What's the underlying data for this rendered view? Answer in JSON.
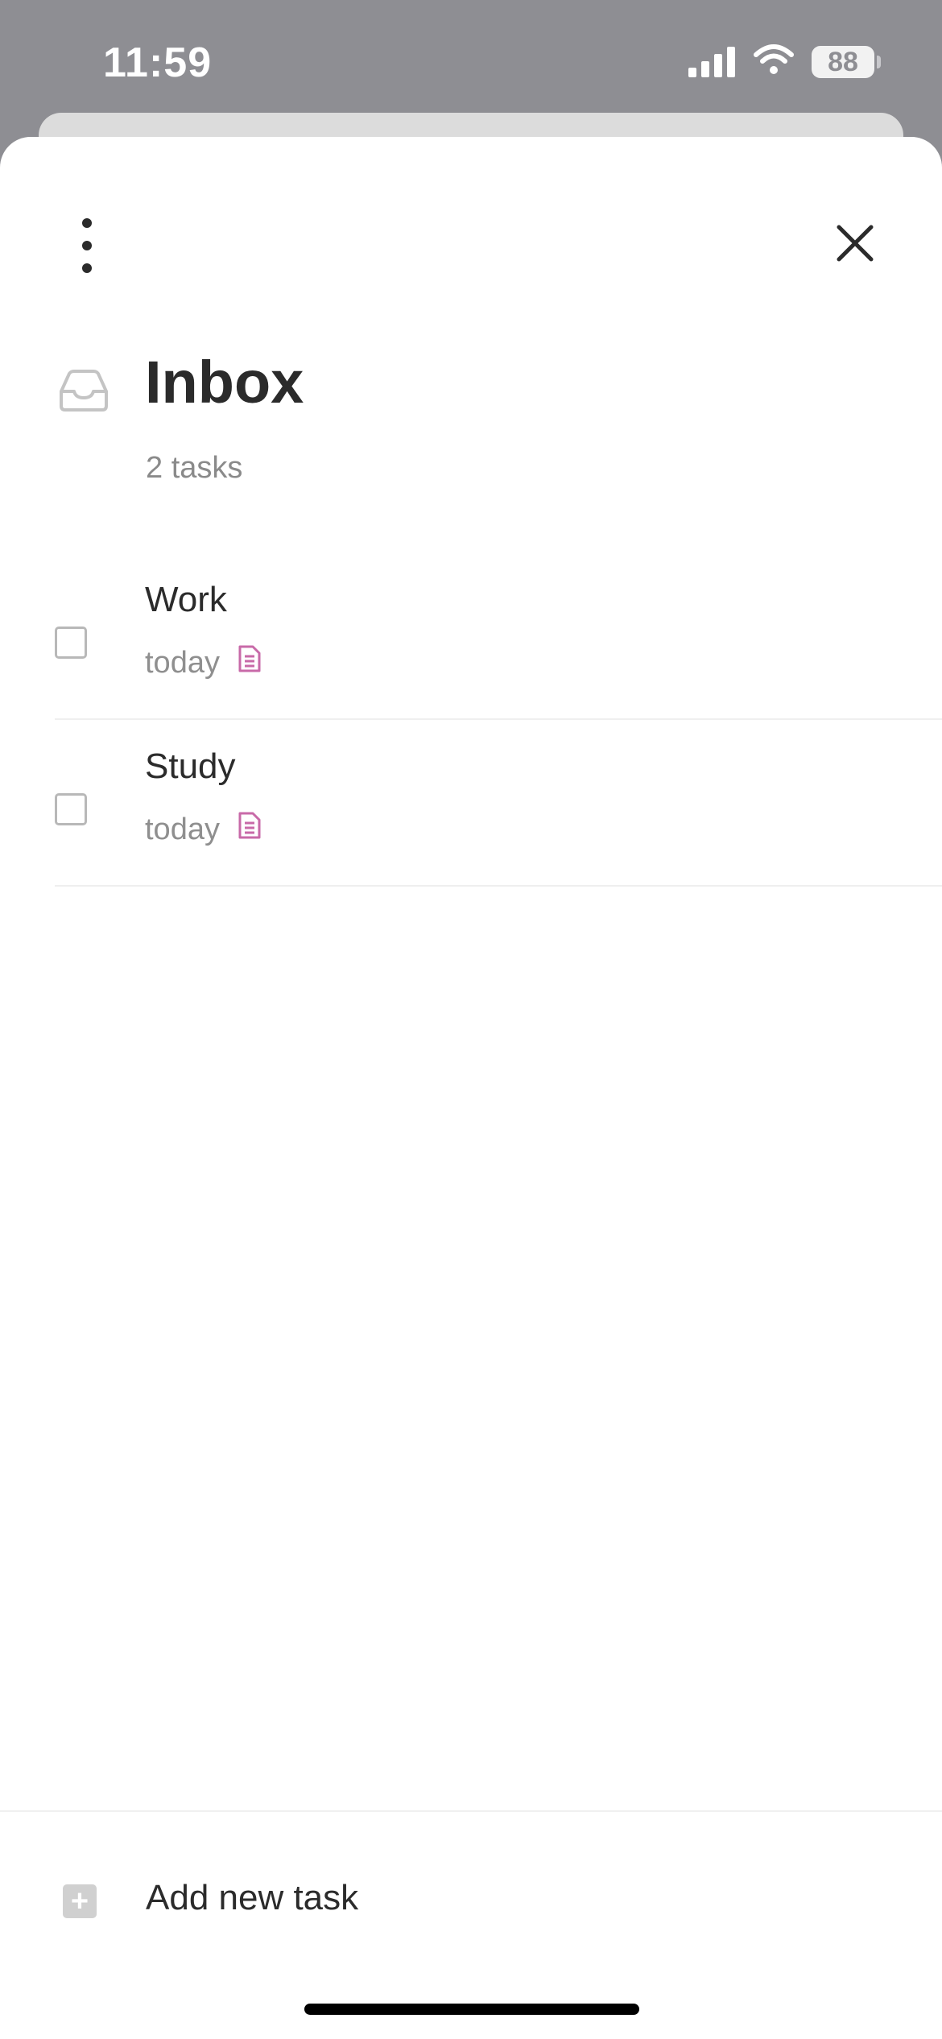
{
  "status_bar": {
    "time": "11:59",
    "battery": "88"
  },
  "header": {
    "title": "Inbox",
    "subtitle": "2 tasks",
    "icons": [
      "more-vertical-icon",
      "close-icon",
      "inbox-tray-icon"
    ]
  },
  "tasks": [
    {
      "title": "Work",
      "due": "today",
      "has_note": true
    },
    {
      "title": "Study",
      "due": "today",
      "has_note": true
    }
  ],
  "footer": {
    "add_label": "Add new task"
  },
  "colors": {
    "note_icon": "#c86aa8",
    "sheet_background": "#ffffff",
    "backdrop": "#8e8e93"
  }
}
